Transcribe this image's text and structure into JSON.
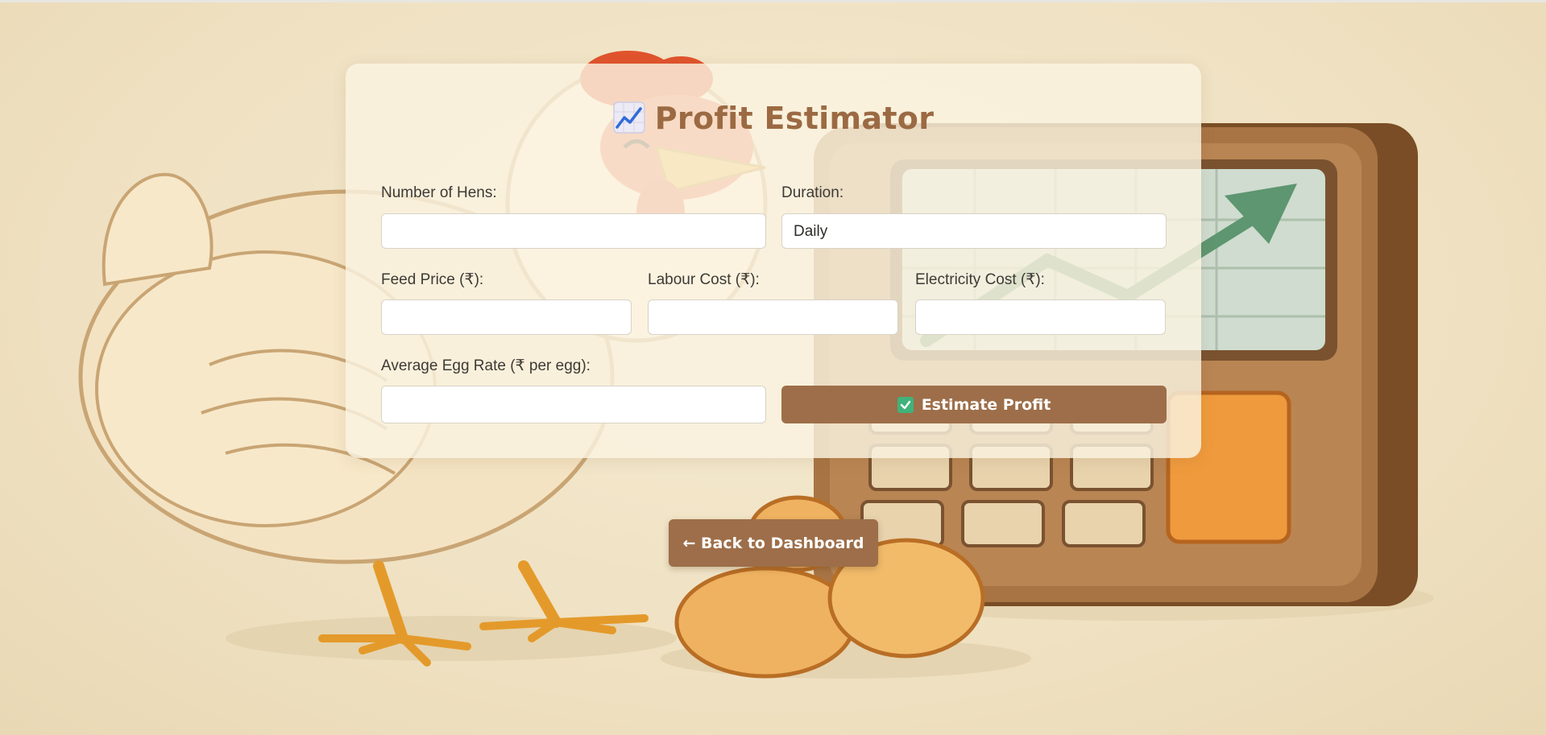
{
  "page": {
    "title": "Profit Estimator",
    "title_icon": "chart-increasing-icon"
  },
  "form": {
    "hens": {
      "label": "Number of Hens:",
      "value": ""
    },
    "duration": {
      "label": "Duration:",
      "value": "Daily"
    },
    "feed_price": {
      "label": "Feed Price (₹):",
      "value": ""
    },
    "labour_cost": {
      "label": "Labour Cost (₹):",
      "value": ""
    },
    "electricity_cost": {
      "label": "Electricity Cost (₹):",
      "value": ""
    },
    "egg_rate": {
      "label": "Average Egg Rate (₹ per egg):",
      "value": ""
    },
    "estimate_button": {
      "label": "Estimate Profit",
      "icon": "check-mark-icon"
    }
  },
  "navigation": {
    "back_button": "← Back to Dashboard"
  },
  "colors": {
    "accent": "#9d6e49",
    "title": "#9b6a43",
    "background": "#f1e5c8",
    "check": "#3fb37a"
  }
}
